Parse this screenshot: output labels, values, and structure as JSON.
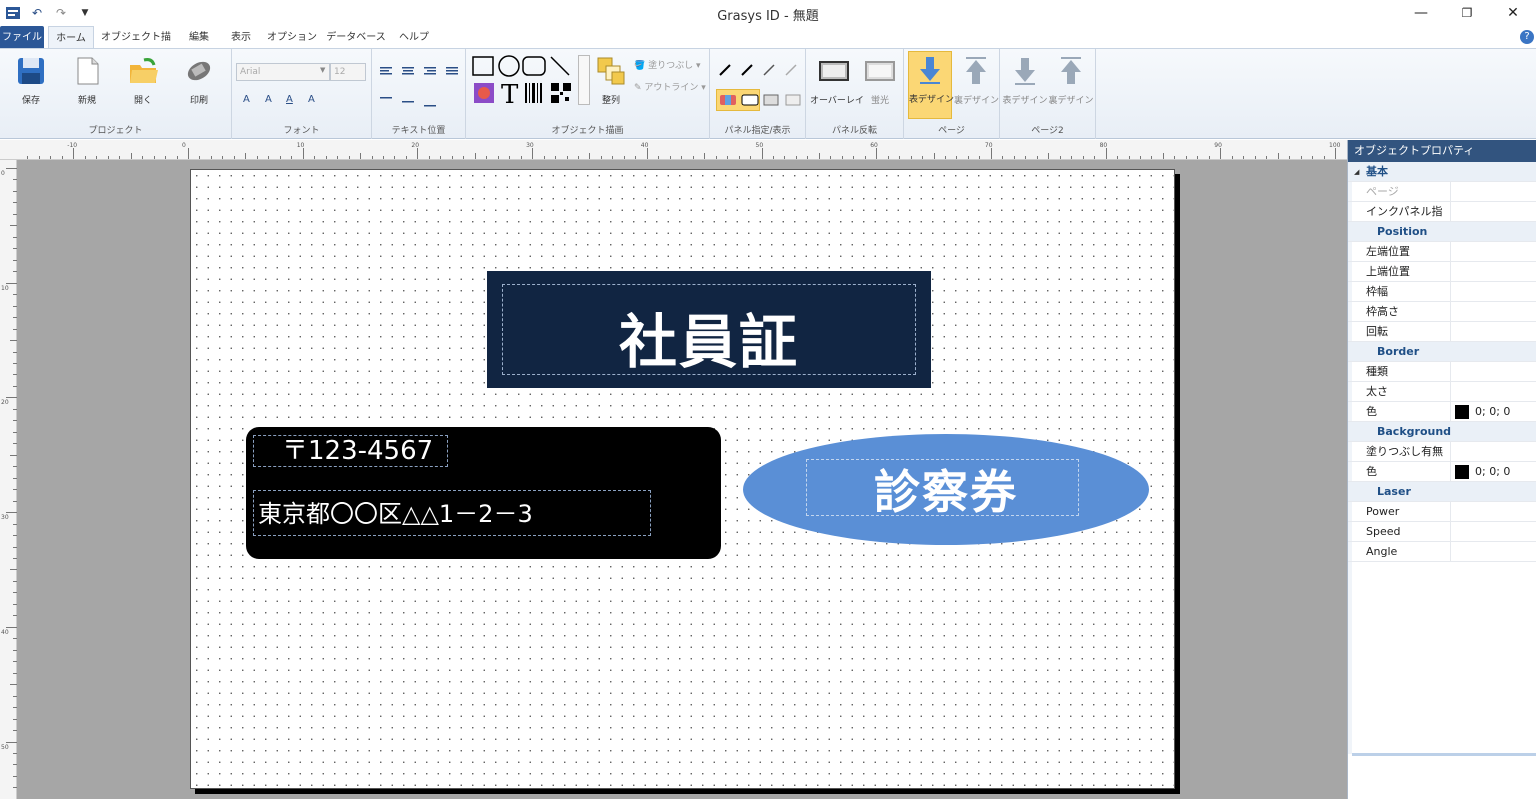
{
  "window": {
    "title": "Grasys ID - 無題",
    "minimize_icon": "minimize-icon",
    "maximize_icon": "restore-icon",
    "close_icon": "close-icon"
  },
  "qat": {
    "undo": "undo-icon",
    "redo": "redo-icon",
    "customize": "customize-icon"
  },
  "tabs": [
    "ファイル",
    "ホーム",
    "オブジェクト描画",
    "編集",
    "表示",
    "オプション",
    "データベース",
    "ヘルプ"
  ],
  "ribbon": {
    "project": {
      "label": "プロジェクト",
      "save": "保存",
      "new": "新規",
      "open": "開く",
      "print": "印刷"
    },
    "font": {
      "label": "フォント",
      "name": "Arial",
      "size": "12",
      "sizes": [
        "A",
        "A",
        "A",
        "A"
      ]
    },
    "text_pos": {
      "label": "テキスト位置"
    },
    "draw": {
      "label": "オブジェクト描画",
      "arrange": "整列",
      "fill": "塗りつぶし",
      "outline": "アウトライン"
    },
    "panel": {
      "label": "パネル指定/表示"
    },
    "flip": {
      "label": "パネル反転",
      "overlay": "オーバーレイ",
      "fluor": "蛍光"
    },
    "page": {
      "label": "ページ",
      "front": "表デザイン",
      "back": "裏デザイン"
    },
    "page2": {
      "label": "ページ2",
      "front": "表デザイン",
      "back": "裏デザイン"
    }
  },
  "ruler": {
    "h_labels": [
      "-10",
      "0",
      "10",
      "20",
      "30",
      "40",
      "50",
      "60",
      "70",
      "80",
      "90",
      "100"
    ],
    "v_labels": [
      "0",
      "10",
      "20",
      "30",
      "40",
      "50"
    ]
  },
  "canvas": {
    "title_text": "社員証",
    "zip_text": "〒123-4567",
    "address_text": "東京都〇〇区△△1－2－3",
    "ellipse_text": "診察券",
    "colors": {
      "title_bg": "#112542",
      "addr_bg": "#000000",
      "ellipse_bg": "#5a8fd6"
    }
  },
  "props": {
    "header": "オブジェクトプロパティ",
    "rows": [
      {
        "type": "top",
        "k": "基本",
        "v": ""
      },
      {
        "type": "dis",
        "k": "ページ",
        "v": ""
      },
      {
        "type": "row",
        "k": "インクパネル指定",
        "v": ""
      },
      {
        "type": "cat",
        "k": "Position",
        "v": ""
      },
      {
        "type": "row",
        "k": "左端位置",
        "v": ""
      },
      {
        "type": "row",
        "k": "上端位置",
        "v": ""
      },
      {
        "type": "row",
        "k": "枠幅",
        "v": ""
      },
      {
        "type": "row",
        "k": "枠高さ",
        "v": ""
      },
      {
        "type": "row",
        "k": "回転",
        "v": ""
      },
      {
        "type": "cat",
        "k": "Border",
        "v": ""
      },
      {
        "type": "row",
        "k": "種類",
        "v": ""
      },
      {
        "type": "row",
        "k": "太さ",
        "v": ""
      },
      {
        "type": "color",
        "k": "色",
        "v": "0; 0; 0"
      },
      {
        "type": "cat",
        "k": "Background",
        "v": ""
      },
      {
        "type": "row",
        "k": "塗りつぶし有無",
        "v": ""
      },
      {
        "type": "color",
        "k": "色",
        "v": "0; 0; 0"
      },
      {
        "type": "cat",
        "k": "Laser",
        "v": ""
      },
      {
        "type": "row",
        "k": "Power",
        "v": ""
      },
      {
        "type": "row",
        "k": "Speed",
        "v": ""
      },
      {
        "type": "row",
        "k": "Angle",
        "v": ""
      }
    ]
  }
}
